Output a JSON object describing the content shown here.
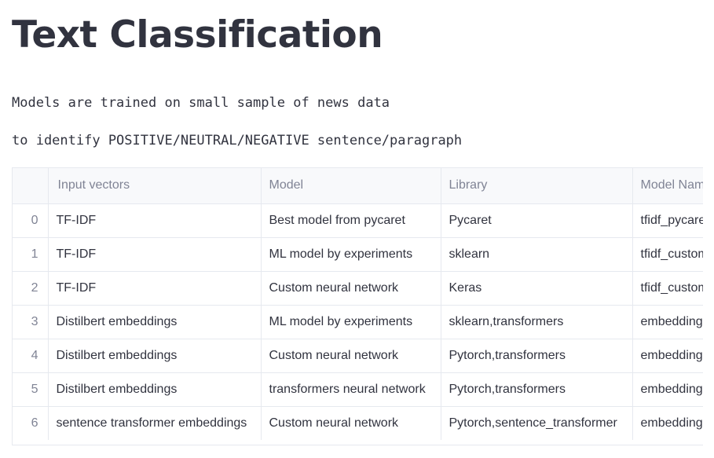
{
  "page": {
    "title": "Text Classification",
    "lines": [
      "Models are trained on small sample of news data",
      "to identify POSITIVE/NEUTRAL/NEGATIVE sentence/paragraph"
    ]
  },
  "table": {
    "columns": [
      "",
      "Input vectors",
      "Model",
      "Library",
      "Model Name"
    ],
    "rows": [
      [
        "0",
        "TF-IDF",
        "Best model from pycaret",
        "Pycaret",
        "tfidf_pycaret"
      ],
      [
        "1",
        " TF-IDF",
        "ML model by experiments",
        "sklearn",
        "tfidf_custom"
      ],
      [
        "2",
        " TF-IDF",
        "Custom neural network",
        "Keras",
        "tfidf_custom"
      ],
      [
        "3",
        "Distilbert embeddings",
        "ML model by experiments",
        "sklearn,transformers",
        "embeddings"
      ],
      [
        "4",
        "Distilbert embeddings",
        "Custom neural network",
        "Pytorch,transformers",
        "embeddings"
      ],
      [
        "5",
        "Distilbert embeddings",
        "transformers neural network",
        "Pytorch,transformers",
        "embeddings"
      ],
      [
        "6",
        "sentence transformer embeddings",
        "Custom neural network",
        "Pytorch,sentence_transformer",
        "embeddings"
      ]
    ]
  },
  "colors": {
    "text": "#31333f",
    "muted": "#808495",
    "border": "#e6e9ef",
    "header_bg": "#f8f9fb"
  }
}
